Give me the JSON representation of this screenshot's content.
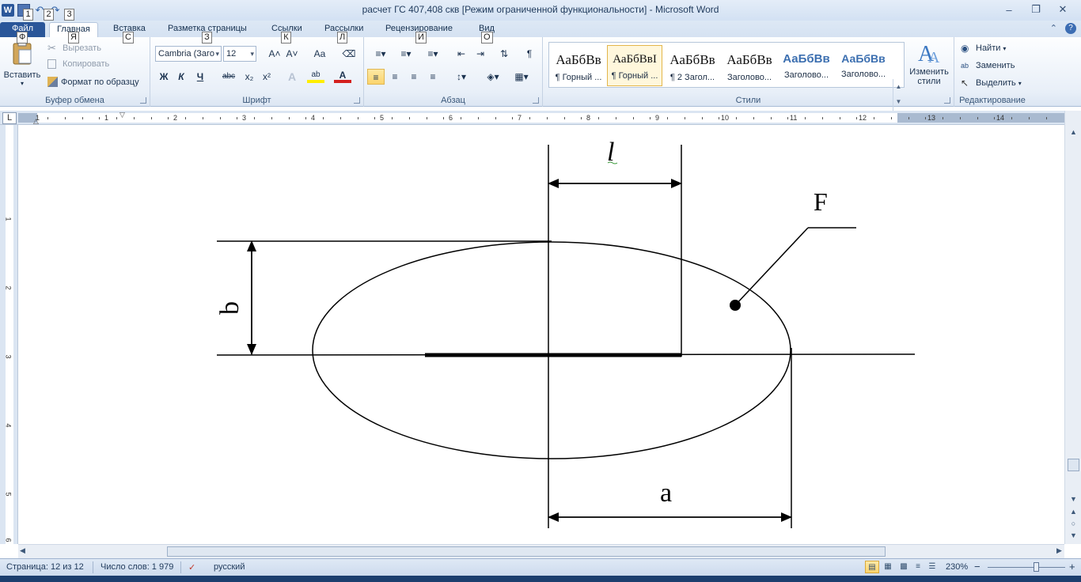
{
  "window": {
    "title": "расчет ГС 407,408 скв [Режим ограниченной функциональности]  -  Microsoft Word",
    "word_logo": "W",
    "minimize": "–",
    "restore": "❐",
    "close": "✕"
  },
  "keytips": {
    "qat": [
      "1",
      "2",
      "3"
    ],
    "tabs": [
      "Ф",
      "Я",
      "С",
      "З",
      "К",
      "Л",
      "И",
      "О"
    ]
  },
  "tabs": [
    {
      "label": "Файл"
    },
    {
      "label": "Главная"
    },
    {
      "label": "Вставка"
    },
    {
      "label": "Разметка страницы"
    },
    {
      "label": "Ссылки"
    },
    {
      "label": "Рассылки"
    },
    {
      "label": "Рецензирование"
    },
    {
      "label": "Вид"
    }
  ],
  "ribbon": {
    "clipboard": {
      "label": "Буфер обмена",
      "paste": "Вставить",
      "cut": "Вырезать",
      "copy": "Копировать",
      "format_painter": "Формат по образцу"
    },
    "font": {
      "label": "Шрифт",
      "font_name": "Cambria (Заго",
      "font_size": "12",
      "grow": "A˄",
      "shrink": "A˅",
      "case": "Aa",
      "bold": "Ж",
      "italic": "К",
      "underline": "Ч",
      "strike": "abc",
      "subscript": "x₂",
      "superscript": "x²",
      "text_effects": "A",
      "highlight": "ab",
      "font_color": "A"
    },
    "paragraph": {
      "label": "Абзац",
      "pilcrow": "¶"
    },
    "styles": {
      "label": "Стили",
      "items": [
        {
          "sample": "АаБбВв",
          "name": "¶ Горный ..."
        },
        {
          "sample": "АаБбВвI",
          "name": "¶ Горный ..."
        },
        {
          "sample": "АаБбВв",
          "name": "¶ 2 Загол..."
        },
        {
          "sample": "АаБбВв",
          "name": "Заголово..."
        },
        {
          "sample": "АаБбВв",
          "name": "Заголово..."
        },
        {
          "sample": "АаБбВв",
          "name": "Заголово..."
        }
      ],
      "change_styles": "Изменить стили"
    },
    "editing": {
      "label": "Редактирование",
      "find": "Найти",
      "replace": "Заменить",
      "select": "Выделить"
    }
  },
  "ruler": {
    "h_numbers": [
      "1",
      "1",
      "2",
      "3",
      "4",
      "5",
      "6",
      "7",
      "8",
      "9",
      "10",
      "11",
      "12",
      "13",
      "14"
    ],
    "v_numbers": [
      "1",
      "2",
      "3",
      "4",
      "5",
      "6"
    ],
    "corner": "L"
  },
  "drawing": {
    "label_l": "l",
    "label_b": "b",
    "label_F": "F",
    "label_a": "a"
  },
  "status": {
    "page": "Страница: 12 из 12",
    "words": "Число слов: 1 979",
    "language": "русский",
    "zoom": "230%",
    "zoom_minus": "−",
    "zoom_plus": "+"
  },
  "colors": {
    "accent": "#2a5699",
    "selected_button": "#fbd46c"
  }
}
